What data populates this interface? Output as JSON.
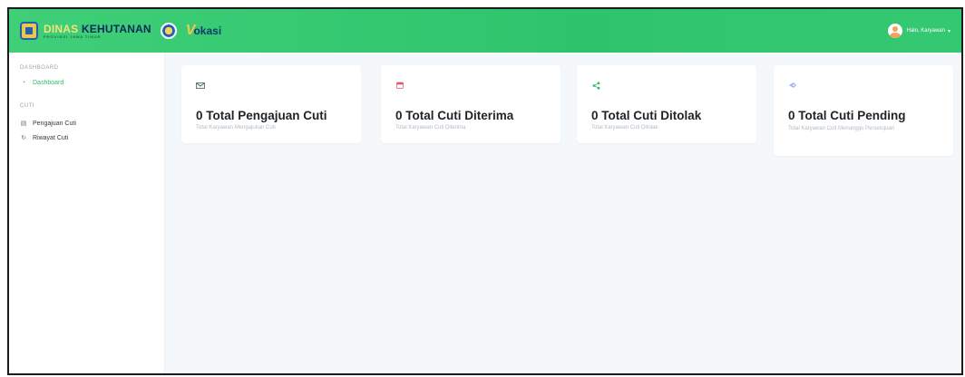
{
  "header": {
    "brand_word1": "DINAS",
    "brand_word2": "KEHUTANAN",
    "brand_subtitle": "PROVINSI JAWA TIMUR",
    "vokasi_first": "V",
    "vokasi_rest": "okasi",
    "user_label": "Halo, Karyawan",
    "colors": {
      "header_green": "#2ec46d",
      "accent": "#2fbf6a"
    }
  },
  "sidebar": {
    "section_dashboard": "DASHBOARD",
    "dashboard_label": "Dashboard",
    "section_cuti": "CUTI",
    "pengajuan_label": "Pengajuan Cuti",
    "riwayat_label": "Riwayat Cuti",
    "icons": [
      "dashboard-icon",
      "file-icon",
      "history-icon"
    ]
  },
  "cards": [
    {
      "title": "0 Total Pengajuan Cuti",
      "subtitle": "Total Karyawan Mengajukan Cuti",
      "icon": "mail-icon"
    },
    {
      "title": "0 Total Cuti Diterima",
      "subtitle": "Total Karyawan Cuti Diterima",
      "icon": "calendar-icon"
    },
    {
      "title": "0 Total Cuti Ditolak",
      "subtitle": "Total Karyawan Cuti Ditolak",
      "icon": "share-icon"
    },
    {
      "title": "0 Total Cuti Pending",
      "subtitle": "Total Karyawan Cuti Menunggu Persetujuan",
      "icon": "rocket-icon"
    }
  ]
}
